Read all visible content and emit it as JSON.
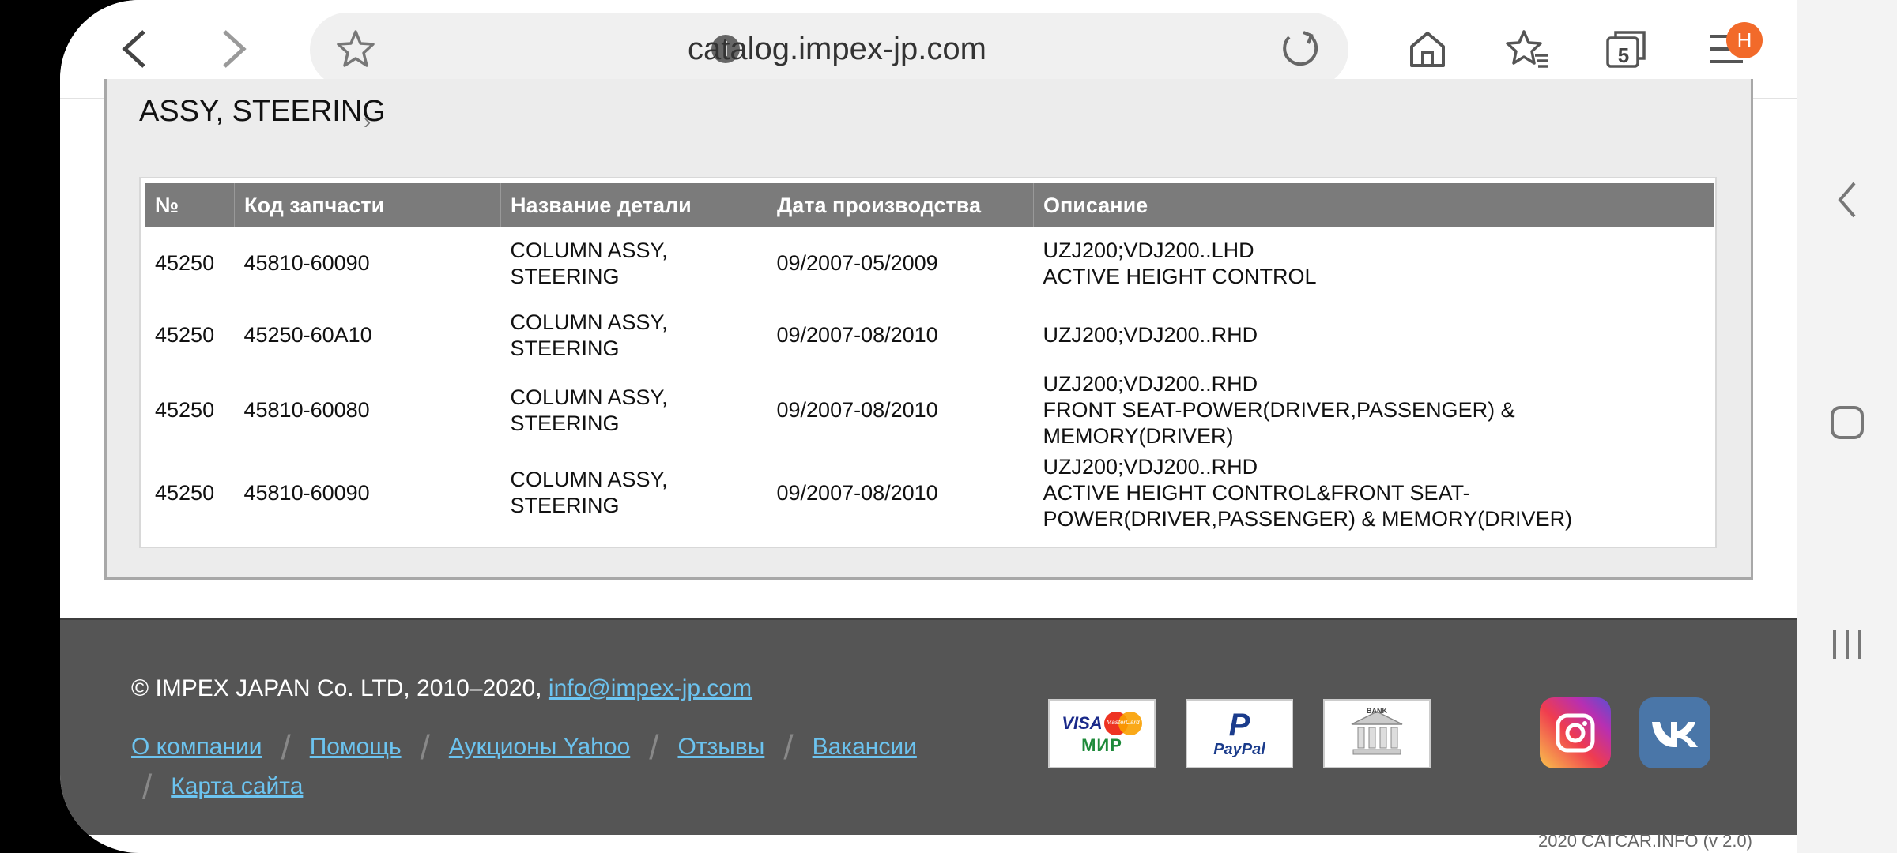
{
  "browser": {
    "url": "catalog.impex-jp.com",
    "tab_count": "5",
    "badge": "H"
  },
  "section": {
    "title": "ASSY, STEERING"
  },
  "table": {
    "headers": [
      "№",
      "Код запчасти",
      "Название детали",
      "Дата производства",
      "Описание"
    ],
    "rows": [
      {
        "no": "45250",
        "code": "45810-60090",
        "name1": "COLUMN ASSY,",
        "name2": "STEERING",
        "date": "09/2007-05/2009",
        "desc1": "UZJ200;VDJ200..LHD",
        "desc2": "ACTIVE HEIGHT CONTROL",
        "desc3": ""
      },
      {
        "no": "45250",
        "code": "45250-60A10",
        "name1": "COLUMN ASSY,",
        "name2": "STEERING",
        "date": "09/2007-08/2010",
        "desc1": "UZJ200;VDJ200..RHD",
        "desc2": "",
        "desc3": ""
      },
      {
        "no": "45250",
        "code": "45810-60080",
        "name1": "COLUMN ASSY,",
        "name2": "STEERING",
        "date": "09/2007-08/2010",
        "desc1": "UZJ200;VDJ200..RHD",
        "desc2": "FRONT SEAT-POWER(DRIVER,PASSENGER) & MEMORY(DRIVER)",
        "desc3": ""
      },
      {
        "no": "45250",
        "code": "45810-60090",
        "name1": "COLUMN ASSY,",
        "name2": "STEERING",
        "date": "09/2007-08/2010",
        "desc1": "UZJ200;VDJ200..RHD",
        "desc2": "ACTIVE HEIGHT CONTROL&FRONT SEAT-",
        "desc3": "POWER(DRIVER,PASSENGER) & MEMORY(DRIVER)"
      }
    ]
  },
  "footer": {
    "copyright": "© IMPEX JAPAN Co. LTD, 2010–2020, ",
    "email": "info@impex-jp.com",
    "links": [
      "О компании",
      "Помощь",
      "Аукционы Yahoo",
      "Отзывы",
      "Вакансии",
      "Карта сайта"
    ],
    "payments": {
      "card_visa": "VISA",
      "card_mc": "MasterCard",
      "card_mir": "МИР",
      "paypal": "PayPal",
      "bank": "BANK"
    },
    "version": "2020 CATCAR.INFO (v 2.0)"
  },
  "colors": {
    "link": "#6cc3ef",
    "header_bg": "#7b7b7b",
    "footer_bg": "#555555",
    "badge": "#f26a2a"
  }
}
